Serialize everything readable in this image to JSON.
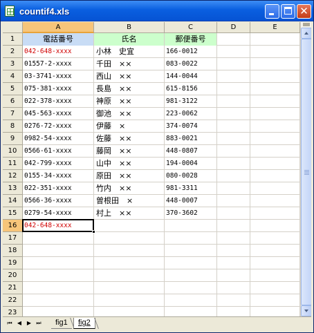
{
  "window": {
    "title": "countif4.xls",
    "icon": "excel-document-icon"
  },
  "columns": [
    "A",
    "B",
    "C",
    "D",
    "E"
  ],
  "active_cell": "A16",
  "row_numbers": [
    "1",
    "2",
    "3",
    "4",
    "5",
    "6",
    "7",
    "8",
    "9",
    "10",
    "11",
    "12",
    "13",
    "14",
    "15",
    "16",
    "17",
    "18",
    "19",
    "20",
    "21",
    "22",
    "23"
  ],
  "header_row": {
    "phone": "電話番号",
    "name": "氏名",
    "zip": "郵便番号"
  },
  "rows": [
    {
      "phone": "042-648-xxxx",
      "name": "小林　史宜",
      "zip": "166-0012",
      "phone_red": true
    },
    {
      "phone": "01557-2-xxxx",
      "name": "千田　××",
      "zip": "083-0022"
    },
    {
      "phone": "03-3741-xxxx",
      "name": "西山　××",
      "zip": "144-0044"
    },
    {
      "phone": "075-381-xxxx",
      "name": "長島　××",
      "zip": "615-8156"
    },
    {
      "phone": "022-378-xxxx",
      "name": "神原　××",
      "zip": "981-3122"
    },
    {
      "phone": "045-563-xxxx",
      "name": "御池　××",
      "zip": "223-0062"
    },
    {
      "phone": "0276-72-xxxx",
      "name": "伊藤　×",
      "zip": "374-0074"
    },
    {
      "phone": "0982-54-xxxx",
      "name": "佐藤　××",
      "zip": "883-0021"
    },
    {
      "phone": "0566-61-xxxx",
      "name": "藤岡　××",
      "zip": "448-0807"
    },
    {
      "phone": "042-799-xxxx",
      "name": "山中　××",
      "zip": "194-0004"
    },
    {
      "phone": "0155-34-xxxx",
      "name": "原田　××",
      "zip": "080-0028"
    },
    {
      "phone": "022-351-xxxx",
      "name": "竹内　××",
      "zip": "981-3311"
    },
    {
      "phone": "0566-36-xxxx",
      "name": "曽根田　×",
      "zip": "448-0007"
    },
    {
      "phone": "0279-54-xxxx",
      "name": "村上　××",
      "zip": "370-3602"
    },
    {
      "phone": "042-648-xxxx",
      "name": "",
      "zip": "",
      "phone_red": true
    }
  ],
  "sheet_tabs": [
    "fig1",
    "fig2"
  ],
  "active_sheet": "fig2",
  "tab_nav": {
    "first": "⏮",
    "prev": "◀",
    "next": "▶",
    "last": "⏭"
  },
  "colors": {
    "header_a_fill": "#c8dcf5",
    "header_bc_fill": "#ccffcc",
    "red_text": "#d00000",
    "title_bar": "#0a5fe0"
  }
}
